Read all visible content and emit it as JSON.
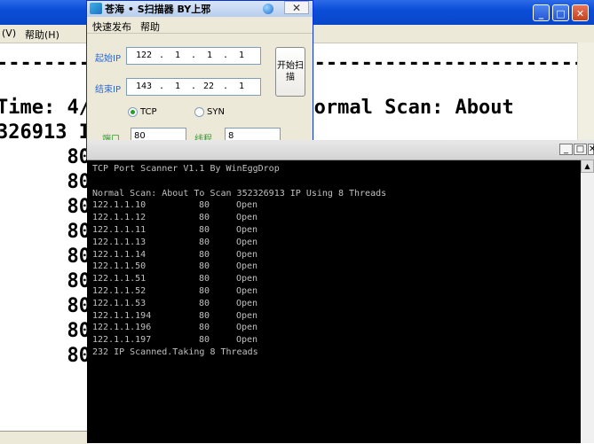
{
  "background_window": {
    "menu": {
      "item_left": "(V)",
      "help": "帮助(H)"
    },
    "lines": [
      "-----------------------------------------------------------",
      "Time: 4/                > Normal Scan: About",
      "326913 I",
      "      80",
      "      80",
      "      80",
      "      80",
      "      80",
      "      80",
      "      80",
      "      80",
      "      80",
      "      80",
      "      80"
    ]
  },
  "scanner": {
    "title": "苍海 • S扫描器   BY上邪",
    "menu": {
      "quick_publish": "快速发布",
      "help": "帮助"
    },
    "start_ip_label": "起始IP",
    "end_ip_label": "结束IP",
    "start_ip": [
      "122",
      "1",
      "1",
      "1"
    ],
    "end_ip": [
      "143",
      "1",
      "22",
      "1"
    ],
    "start_button": "开始扫描",
    "tcp_label": "TCP",
    "syn_label": "SYN",
    "port_label": "端口",
    "port_value": "80",
    "threads_label": "线程",
    "threads_value": "8"
  },
  "console": {
    "header": "TCP Port Scanner V1.1 By WinEggDrop",
    "scan_info": "Normal Scan: About To Scan 352326913 IP Using 8 Threads",
    "results": [
      {
        "ip": "122.1.1.10",
        "port": "80",
        "status": "Open"
      },
      {
        "ip": "122.1.1.12",
        "port": "80",
        "status": "Open"
      },
      {
        "ip": "122.1.1.11",
        "port": "80",
        "status": "Open"
      },
      {
        "ip": "122.1.1.13",
        "port": "80",
        "status": "Open"
      },
      {
        "ip": "122.1.1.14",
        "port": "80",
        "status": "Open"
      },
      {
        "ip": "122.1.1.50",
        "port": "80",
        "status": "Open"
      },
      {
        "ip": "122.1.1.51",
        "port": "80",
        "status": "Open"
      },
      {
        "ip": "122.1.1.52",
        "port": "80",
        "status": "Open"
      },
      {
        "ip": "122.1.1.53",
        "port": "80",
        "status": "Open"
      },
      {
        "ip": "122.1.1.194",
        "port": "80",
        "status": "Open"
      },
      {
        "ip": "122.1.1.196",
        "port": "80",
        "status": "Open"
      },
      {
        "ip": "122.1.1.197",
        "port": "80",
        "status": "Open"
      }
    ],
    "footer": "232 IP Scanned.Taking 8 Threads"
  }
}
